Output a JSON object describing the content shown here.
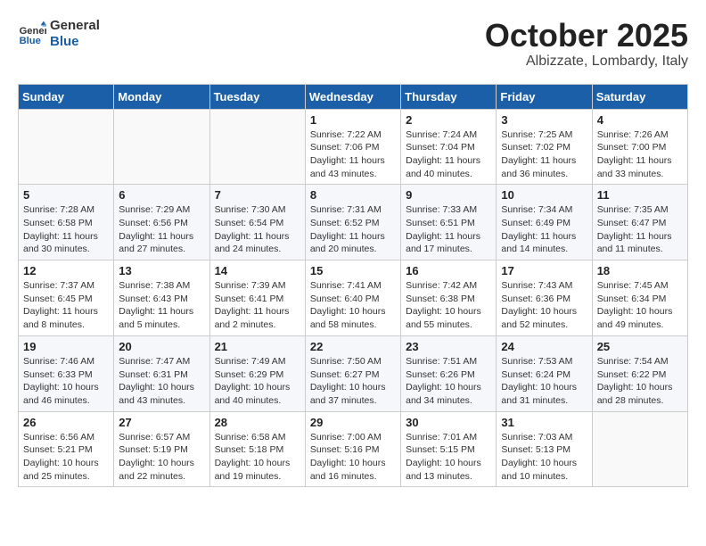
{
  "header": {
    "logo_line1": "General",
    "logo_line2": "Blue",
    "month_title": "October 2025",
    "location": "Albizzate, Lombardy, Italy"
  },
  "days_of_week": [
    "Sunday",
    "Monday",
    "Tuesday",
    "Wednesday",
    "Thursday",
    "Friday",
    "Saturday"
  ],
  "weeks": [
    [
      {
        "day": "",
        "info": ""
      },
      {
        "day": "",
        "info": ""
      },
      {
        "day": "",
        "info": ""
      },
      {
        "day": "1",
        "info": "Sunrise: 7:22 AM\nSunset: 7:06 PM\nDaylight: 11 hours and 43 minutes."
      },
      {
        "day": "2",
        "info": "Sunrise: 7:24 AM\nSunset: 7:04 PM\nDaylight: 11 hours and 40 minutes."
      },
      {
        "day": "3",
        "info": "Sunrise: 7:25 AM\nSunset: 7:02 PM\nDaylight: 11 hours and 36 minutes."
      },
      {
        "day": "4",
        "info": "Sunrise: 7:26 AM\nSunset: 7:00 PM\nDaylight: 11 hours and 33 minutes."
      }
    ],
    [
      {
        "day": "5",
        "info": "Sunrise: 7:28 AM\nSunset: 6:58 PM\nDaylight: 11 hours and 30 minutes."
      },
      {
        "day": "6",
        "info": "Sunrise: 7:29 AM\nSunset: 6:56 PM\nDaylight: 11 hours and 27 minutes."
      },
      {
        "day": "7",
        "info": "Sunrise: 7:30 AM\nSunset: 6:54 PM\nDaylight: 11 hours and 24 minutes."
      },
      {
        "day": "8",
        "info": "Sunrise: 7:31 AM\nSunset: 6:52 PM\nDaylight: 11 hours and 20 minutes."
      },
      {
        "day": "9",
        "info": "Sunrise: 7:33 AM\nSunset: 6:51 PM\nDaylight: 11 hours and 17 minutes."
      },
      {
        "day": "10",
        "info": "Sunrise: 7:34 AM\nSunset: 6:49 PM\nDaylight: 11 hours and 14 minutes."
      },
      {
        "day": "11",
        "info": "Sunrise: 7:35 AM\nSunset: 6:47 PM\nDaylight: 11 hours and 11 minutes."
      }
    ],
    [
      {
        "day": "12",
        "info": "Sunrise: 7:37 AM\nSunset: 6:45 PM\nDaylight: 11 hours and 8 minutes."
      },
      {
        "day": "13",
        "info": "Sunrise: 7:38 AM\nSunset: 6:43 PM\nDaylight: 11 hours and 5 minutes."
      },
      {
        "day": "14",
        "info": "Sunrise: 7:39 AM\nSunset: 6:41 PM\nDaylight: 11 hours and 2 minutes."
      },
      {
        "day": "15",
        "info": "Sunrise: 7:41 AM\nSunset: 6:40 PM\nDaylight: 10 hours and 58 minutes."
      },
      {
        "day": "16",
        "info": "Sunrise: 7:42 AM\nSunset: 6:38 PM\nDaylight: 10 hours and 55 minutes."
      },
      {
        "day": "17",
        "info": "Sunrise: 7:43 AM\nSunset: 6:36 PM\nDaylight: 10 hours and 52 minutes."
      },
      {
        "day": "18",
        "info": "Sunrise: 7:45 AM\nSunset: 6:34 PM\nDaylight: 10 hours and 49 minutes."
      }
    ],
    [
      {
        "day": "19",
        "info": "Sunrise: 7:46 AM\nSunset: 6:33 PM\nDaylight: 10 hours and 46 minutes."
      },
      {
        "day": "20",
        "info": "Sunrise: 7:47 AM\nSunset: 6:31 PM\nDaylight: 10 hours and 43 minutes."
      },
      {
        "day": "21",
        "info": "Sunrise: 7:49 AM\nSunset: 6:29 PM\nDaylight: 10 hours and 40 minutes."
      },
      {
        "day": "22",
        "info": "Sunrise: 7:50 AM\nSunset: 6:27 PM\nDaylight: 10 hours and 37 minutes."
      },
      {
        "day": "23",
        "info": "Sunrise: 7:51 AM\nSunset: 6:26 PM\nDaylight: 10 hours and 34 minutes."
      },
      {
        "day": "24",
        "info": "Sunrise: 7:53 AM\nSunset: 6:24 PM\nDaylight: 10 hours and 31 minutes."
      },
      {
        "day": "25",
        "info": "Sunrise: 7:54 AM\nSunset: 6:22 PM\nDaylight: 10 hours and 28 minutes."
      }
    ],
    [
      {
        "day": "26",
        "info": "Sunrise: 6:56 AM\nSunset: 5:21 PM\nDaylight: 10 hours and 25 minutes."
      },
      {
        "day": "27",
        "info": "Sunrise: 6:57 AM\nSunset: 5:19 PM\nDaylight: 10 hours and 22 minutes."
      },
      {
        "day": "28",
        "info": "Sunrise: 6:58 AM\nSunset: 5:18 PM\nDaylight: 10 hours and 19 minutes."
      },
      {
        "day": "29",
        "info": "Sunrise: 7:00 AM\nSunset: 5:16 PM\nDaylight: 10 hours and 16 minutes."
      },
      {
        "day": "30",
        "info": "Sunrise: 7:01 AM\nSunset: 5:15 PM\nDaylight: 10 hours and 13 minutes."
      },
      {
        "day": "31",
        "info": "Sunrise: 7:03 AM\nSunset: 5:13 PM\nDaylight: 10 hours and 10 minutes."
      },
      {
        "day": "",
        "info": ""
      }
    ]
  ]
}
